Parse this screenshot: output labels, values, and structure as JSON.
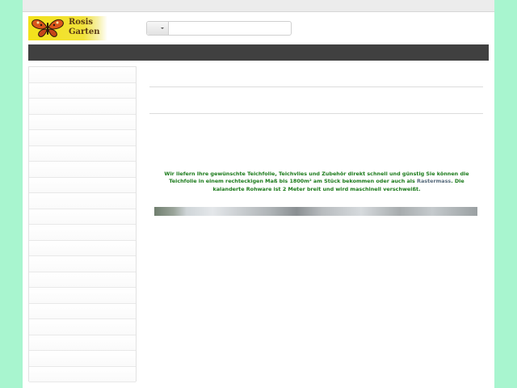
{
  "header": {
    "logo_line1": "Rosis",
    "logo_line2": "Garten",
    "search": {
      "placeholder": "",
      "value": ""
    }
  },
  "sidebar": {
    "items": [
      "",
      "",
      "",
      "",
      "",
      "",
      "",
      "",
      "",
      "",
      "",
      "",
      "",
      "",
      "",
      "",
      "",
      "",
      "",
      ""
    ]
  },
  "content": {
    "intro_part1": "Wir liefern Ihre gewünschte Teichfolie, Teichvlies  und Zubehör direkt schnell und günstig Sie können die Teichfolie in einem rechteckigen Maß bis 1800m² am Stück bekommen oder auch als ",
    "intro_highlight": "Rastermass",
    "intro_part2": ". Die kalanderte Rohware ist 2 Meter breit und wird maschinell verschweißt."
  },
  "icons": {
    "logo": "butterfly-icon",
    "dropdown": "caret-down-icon"
  },
  "colors": {
    "background": "#a8f5cf",
    "navbar": "#404040",
    "intro_text": "#1a7a1a",
    "logo_bg": "#f3e21a"
  }
}
